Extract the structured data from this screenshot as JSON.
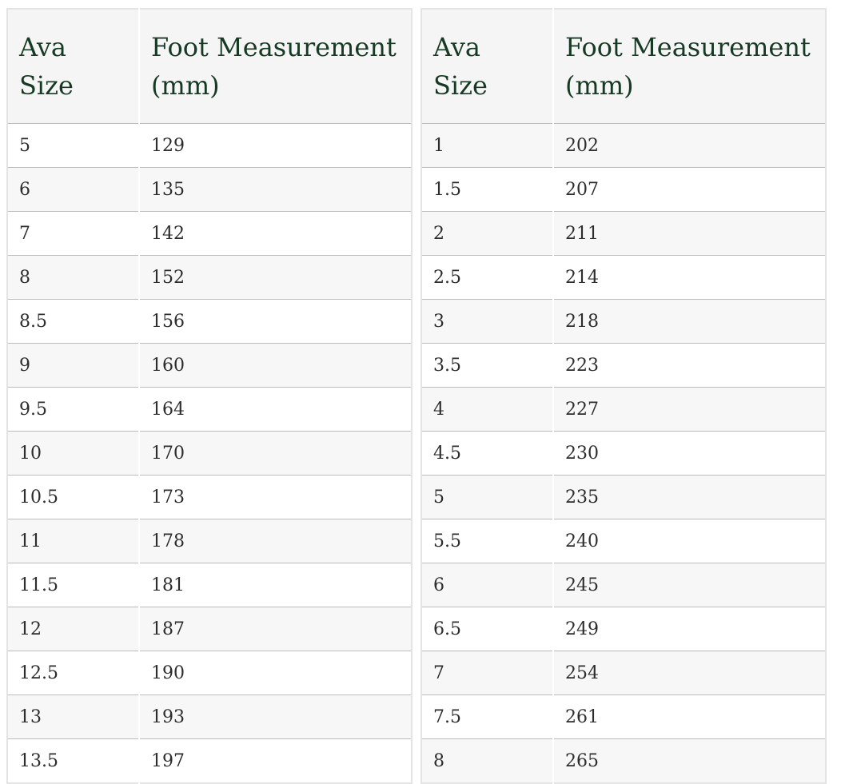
{
  "left_table": {
    "header_size": "Ava Size",
    "header_measure": "Foot Measurement (mm)",
    "rows": [
      [
        "5",
        "129"
      ],
      [
        "6",
        "135"
      ],
      [
        "7",
        "142"
      ],
      [
        "8",
        "152"
      ],
      [
        "8.5",
        "156"
      ],
      [
        "9",
        "160"
      ],
      [
        "9.5",
        "164"
      ],
      [
        "10",
        "170"
      ],
      [
        "10.5",
        "173"
      ],
      [
        "11",
        "178"
      ],
      [
        "11.5",
        "181"
      ],
      [
        "12",
        "187"
      ],
      [
        "12.5",
        "190"
      ],
      [
        "13",
        "193"
      ],
      [
        "13.5",
        "197"
      ]
    ]
  },
  "right_table": {
    "header_size": "Ava Size",
    "header_measure": "Foot Measurement (mm)",
    "rows": [
      [
        "1",
        "202"
      ],
      [
        "1.5",
        "207"
      ],
      [
        "2",
        "211"
      ],
      [
        "2.5",
        "214"
      ],
      [
        "3",
        "218"
      ],
      [
        "3.5",
        "223"
      ],
      [
        "4",
        "227"
      ],
      [
        "4.5",
        "230"
      ],
      [
        "5",
        "235"
      ],
      [
        "5.5",
        "240"
      ],
      [
        "6",
        "245"
      ],
      [
        "6.5",
        "249"
      ],
      [
        "7",
        "254"
      ],
      [
        "7.5",
        "261"
      ],
      [
        "8",
        "265"
      ]
    ]
  },
  "colors": {
    "header_text": "#163a23",
    "header_bg": "#f5f5f5",
    "row_alt_bg": "#f7f7f7",
    "border": "#e4e4e4"
  }
}
